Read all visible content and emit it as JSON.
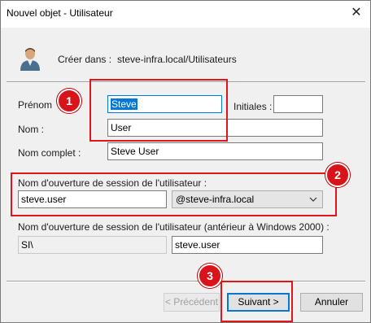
{
  "window": {
    "title": "Nouvel objet - Utilisateur",
    "close_glyph": "✕",
    "icon": "user-icon"
  },
  "header": {
    "create_in_label": "Créer dans :",
    "create_in_path": "steve-infra.local/Utilisateurs"
  },
  "form": {
    "first_name_label": "Prénom",
    "first_name_value": "Steve",
    "initials_label": "Initiales :",
    "initials_value": "",
    "last_name_label": "Nom :",
    "last_name_value": "User",
    "full_name_label": "Nom complet :",
    "full_name_value": "Steve User",
    "logon_label": "Nom d'ouverture de session de l'utilisateur :",
    "logon_value": "steve.user",
    "domain_value": "@steve-infra.local",
    "legacy_label": "Nom d'ouverture de session de l'utilisateur (antérieur à Windows 2000) :",
    "legacy_domain_value": "SI\\",
    "legacy_user_value": "steve.user"
  },
  "buttons": {
    "back_label": "< Précédent",
    "next_label": "Suivant >",
    "cancel_label": "Annuler"
  },
  "annotations": {
    "badge_1": "1",
    "badge_2": "2",
    "badge_3": "3"
  },
  "colors": {
    "highlight": "#e0161b",
    "badge": "#d8141a",
    "accent": "#0078d7"
  }
}
